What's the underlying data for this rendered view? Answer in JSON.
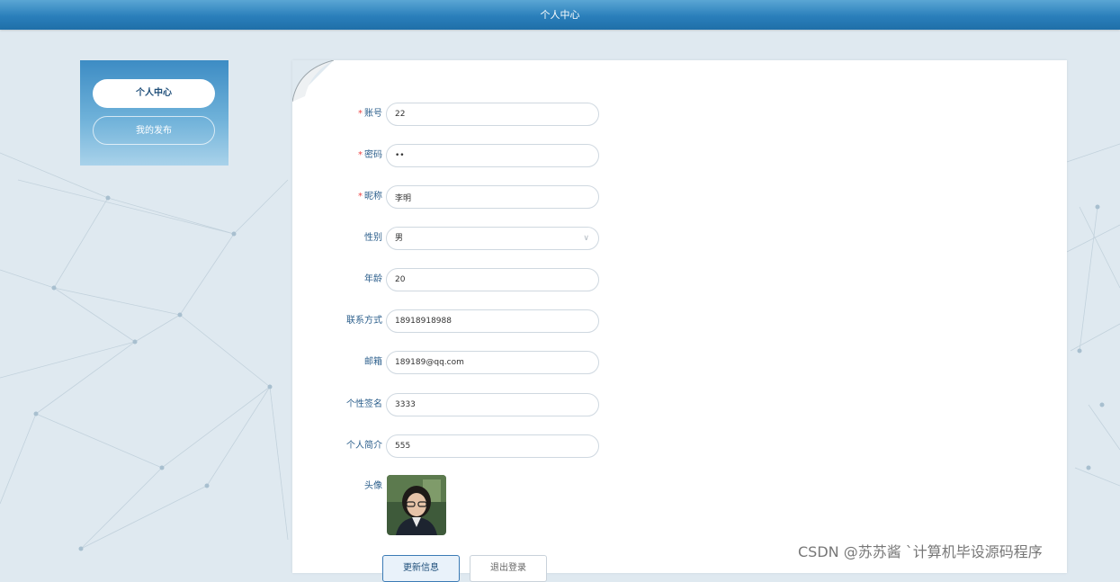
{
  "header": {
    "title": "个人中心"
  },
  "sidebar": {
    "items": [
      {
        "label": "个人中心",
        "active": true
      },
      {
        "label": "我的发布",
        "active": false
      }
    ]
  },
  "form": {
    "fields": {
      "account": {
        "label": "账号",
        "value": "22",
        "required": true
      },
      "password": {
        "label": "密码",
        "value": "••",
        "required": true
      },
      "nickname": {
        "label": "昵称",
        "value": "李明",
        "required": true
      },
      "gender": {
        "label": "性别",
        "value": "男"
      },
      "age": {
        "label": "年龄",
        "value": "20"
      },
      "contact": {
        "label": "联系方式",
        "value": "18918918988"
      },
      "email": {
        "label": "邮箱",
        "value": "189189@qq.com"
      },
      "signature": {
        "label": "个性签名",
        "value": "3333"
      },
      "intro": {
        "label": "个人简介",
        "value": "555"
      },
      "avatar": {
        "label": "头像"
      }
    },
    "required_mark": "*",
    "buttons": {
      "update": "更新信息",
      "logout": "退出登录"
    }
  },
  "icons": {
    "gender_dropdown": "chevron-down-icon"
  },
  "colors": {
    "header_blue": "#2a7fbb",
    "label_blue": "#2c5f8c",
    "required_red": "#ee4444"
  },
  "watermark": "CSDN @苏苏酱   `计算机毕设源码程序"
}
